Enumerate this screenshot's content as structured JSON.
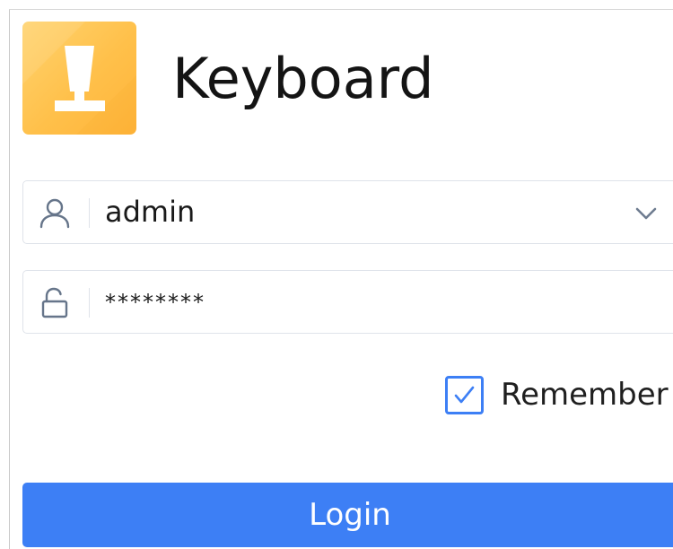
{
  "app": {
    "title": "Keyboard",
    "logo_icon": "keycap-icon",
    "logo_colors": [
      "#ffd36e",
      "#ffb43a"
    ]
  },
  "login_form": {
    "username": {
      "icon": "user-icon",
      "value": "admin",
      "dropdown_icon": "chevron-down-icon"
    },
    "password": {
      "icon": "unlock-icon",
      "value": "********"
    },
    "remember": {
      "label": "Remember",
      "checked": true
    },
    "login_button": {
      "label": "Login",
      "color": "#3d7ff5"
    }
  }
}
